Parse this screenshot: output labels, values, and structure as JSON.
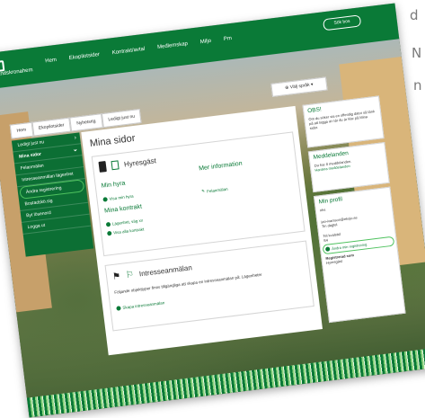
{
  "background_text": {
    "line1": "d",
    "line2": "N",
    "line3": "n"
  },
  "header": {
    "logo_text": "Landskronahem",
    "nav": [
      "Hem",
      "Ekopilotsider",
      "Kontrakt/avtal",
      "Medlemskap",
      "Miljo",
      "Pm"
    ],
    "login": "Sök bos"
  },
  "breadcrumbs": [
    "Hem",
    "Ekopilotsider",
    "Nyhetsrtg",
    "Ledigt just nu"
  ],
  "language": "Välj språk",
  "sidebar": {
    "items": [
      {
        "label": "Ledigt just nu",
        "heading": false,
        "chevron": true
      },
      {
        "label": "Mina sidor",
        "heading": true,
        "chevron": true
      },
      {
        "label": "Felanmälan",
        "heading": false,
        "chevron": false
      },
      {
        "label": "Intresseanmälan lägenhet",
        "heading": false,
        "chevron": false
      },
      {
        "label": "Ändra registrering",
        "heading": false,
        "chevron": false
      },
      {
        "label": "Bostadskö.sig",
        "heading": false,
        "chevron": false
      },
      {
        "label": "Byt lösenord",
        "heading": false,
        "chevron": false
      },
      {
        "label": "Logga ut",
        "heading": false,
        "chevron": false
      }
    ]
  },
  "main": {
    "title": "Mina sidor",
    "hyresgast_title": "Hyresgäst",
    "min_hyra": "Min hyra",
    "mer_information": "Mer information",
    "visa_min_hyra": "Visa min hyra",
    "felanmalan": "Felanmälan",
    "mitt_kontrakt": "Mina kontrakt",
    "lagenhet": "Lägenhet, väg xx",
    "visa_alla": "Visa alla kontrakt",
    "intresse_title": "Intresseanmälan",
    "intresse_text": "Följande objekttyper finns tillgängliga att skapa en intresseanmälan på: Lägenheter",
    "skapa_link": "Skapa intresseanmälan"
  },
  "right": {
    "obs_title": "OBS!",
    "obs_text": "Om du söker via en offentlig dator så tänk på att logga ut när du är klar på Mina sidor.",
    "medd_title": "Meddelanden",
    "medd_text": "Du har 0 meddelanden.",
    "medd_link": "Hantera meddelanden",
    "profil_title": "Min profil",
    "profil_name": "nhs",
    "profil_email": "jan-ivarsson@ekojo.se",
    "profil_mobile": "Tin dagtel",
    "profil_kval": "Tel kvalstid",
    "profil_kval_val": "S4",
    "profil_link": "Ändra min registrering",
    "profil_type_label": "Registrerad som",
    "profil_type": "Hyresgäst"
  }
}
